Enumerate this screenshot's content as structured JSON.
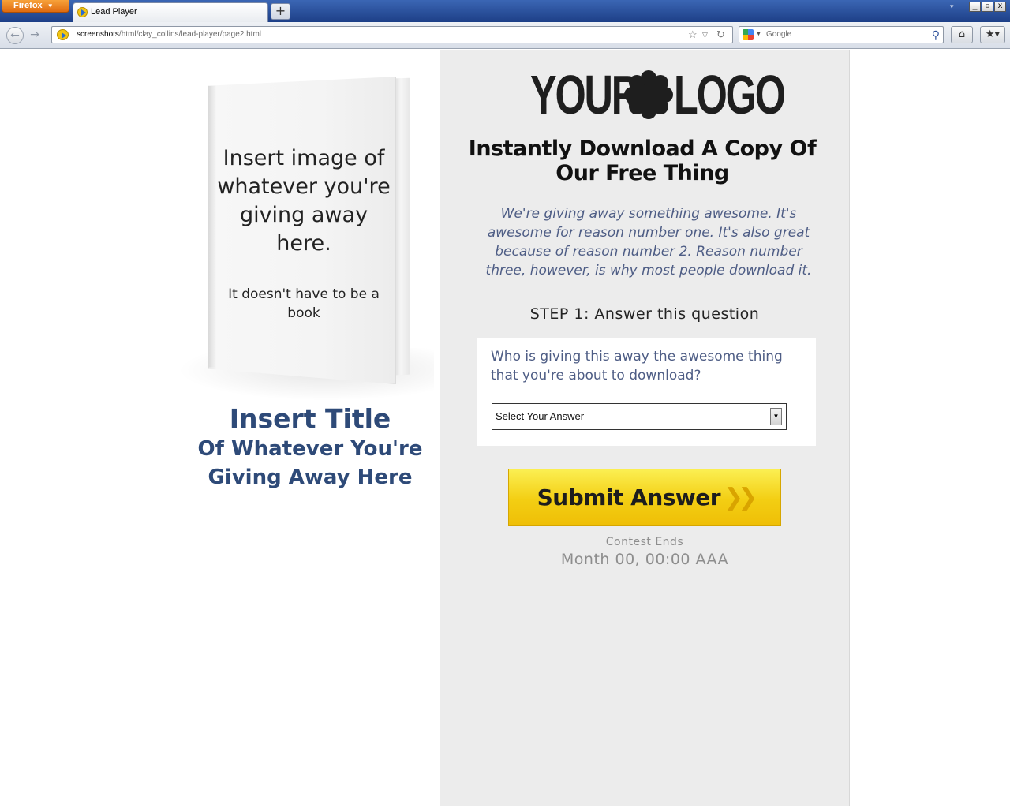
{
  "browser": {
    "app_menu_label": "Firefox",
    "tab_title": "Lead Player",
    "new_tab_label": "+",
    "url_host": "screenshots",
    "url_path": "/html/clay_collins/lead-player/page2.html",
    "search_placeholder": "Google",
    "window_controls": {
      "minimize": "_",
      "restore": "▫",
      "close": "x"
    }
  },
  "book": {
    "main_text": "Insert image of whatever you're giving away here.",
    "sub_text": "It doesn't have to be a book"
  },
  "offer_title": {
    "line1": "Insert Title",
    "line2": "Of Whatever You're Giving Away Here"
  },
  "logo": {
    "left_word": "YOUR",
    "right_word": "LOGO"
  },
  "headline": "Instantly Download A Copy Of Our Free Thing",
  "description": "We're giving away something awesome. It's awesome for reason number one. It's also great because of reason number 2. Reason number three, however, is why most people download it.",
  "step_label": "STEP 1: Answer this question",
  "question": {
    "text": "Who is giving this away the awesome thing that you're about to download?",
    "select_value": "Select Your Answer"
  },
  "submit_label": "Submit Answer",
  "contest": {
    "label": "Contest Ends",
    "date": "Month 00, 00:00 AAA"
  },
  "colors": {
    "accent_blue": "#2e4a78",
    "button_yellow": "#f3ce13",
    "panel_gray": "#ececec"
  }
}
